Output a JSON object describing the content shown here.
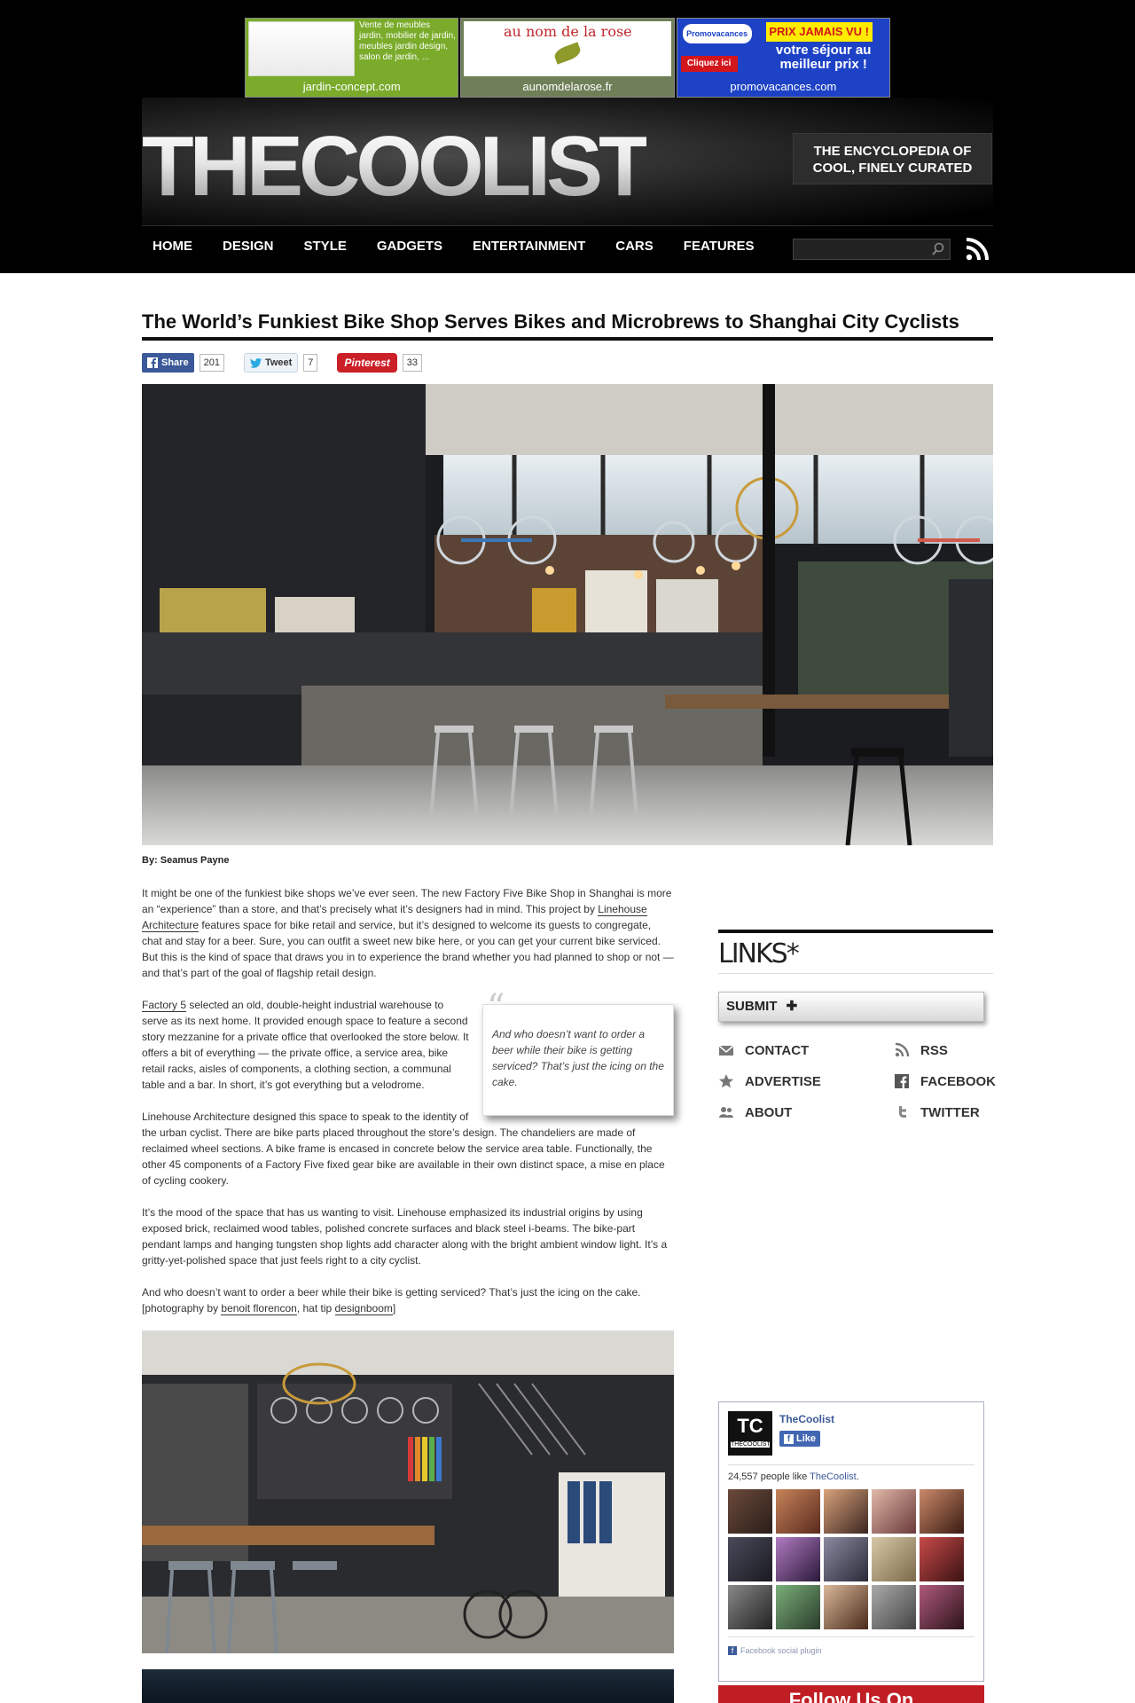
{
  "ads": [
    {
      "text": "Vente de meubles jardin, mobilier de jardin, meubles jardin design, salon de jardin, ...",
      "footer": "jardin-concept.com",
      "color": "#7aab2a"
    },
    {
      "headline": "au nom de la rose",
      "footer": "aunomdelarose.fr",
      "color": "#6f7f58"
    },
    {
      "logo": "Promovacances",
      "cta": "Cliquez ici",
      "badge": "PRIX JAMAIS VU !",
      "offer": "votre séjour au meilleur prix !",
      "footer": "promovacances.com",
      "color": "#1d42c6"
    }
  ],
  "site": {
    "logo": "THECOOLIST",
    "tagline": "THE ENCYCLOPEDIA OF COOL, FINELY CURATED"
  },
  "nav": {
    "items": [
      "HOME",
      "DESIGN",
      "STYLE",
      "GADGETS",
      "ENTERTAINMENT",
      "CARS",
      "FEATURES"
    ],
    "search_placeholder": "",
    "rss_icon": "rss-icon"
  },
  "article": {
    "title": "The World’s Funkiest Bike Shop Serves Bikes and Microbrews to Shanghai City Cyclists",
    "share": {
      "facebook_label": "Share",
      "facebook_count": "201",
      "twitter_label": "Tweet",
      "twitter_count": "7",
      "pinterest_label": "Pinterest",
      "pinterest_count": "33"
    },
    "byline": "By: Seamus Payne",
    "p1_a": "It might be one of the funkiest bike shops we’ve ever seen. The new Factory Five Bike Shop in Shanghai is more an “experience” than a store, and that’s precisely what it’s designers had in mind. This project by ",
    "p1_link": "Linehouse Architecture",
    "p1_b": " features space for bike retail and service, but it’s designed to welcome its guests to congregate, chat and stay for a beer. Sure, you can outfit a sweet new bike here, or you can get your current bike serviced. But this is the kind of space that draws you in to experience the brand whether you had planned to shop or not — and that’s part of the goal of flagship retail design.",
    "quote": "And who doesn’t want to order a beer while their bike is getting serviced? That’s just the icing on the cake.",
    "p2_link": "Factory 5",
    "p2_b": " selected an old, double-height industrial warehouse to serve as its next home. It provided enough space to feature a second story mezzanine for a private office that overlooked the store below. It offers a bit of everything — the private office, a service area, bike retail racks, aisles of components, a clothing section, a communal table and a bar. In short, it’s got everything but a velodrome.",
    "p3": "Linehouse Architecture designed this space to speak to the identity of the urban cyclist. There are bike parts placed throughout the store’s design. The chandeliers are made of reclaimed wheel sections. A bike frame is encased in concrete below the service area table. Functionally, the other 45 components of a Factory Five fixed gear bike are available in their own distinct space, a mise en place of cycling cookery.",
    "p4": "It’s the mood of the space that has us wanting to visit. Linehouse emphasized its industrial origins by using exposed brick, reclaimed wood tables, polished concrete surfaces and black steel i-beams. The bike-part pendant lamps and hanging tungsten shop lights add character along with the bright ambient window light. It’s a gritty-yet-polished space that just feels right to a city cyclist.",
    "p5_a": "And who doesn’t want to order a beer while their bike is getting serviced? That’s just the icing on the cake. [photography by ",
    "p5_link1": "benoit florencon",
    "p5_mid": ", hat tip ",
    "p5_link2": "designboom",
    "p5_end": "]"
  },
  "sidebar": {
    "links_title": "LINKS*",
    "submit_label": "SUBMIT",
    "links": [
      {
        "label": "CONTACT",
        "icon": "mail-icon"
      },
      {
        "label": "RSS",
        "icon": "rss-icon"
      },
      {
        "label": "ADVERTISE",
        "icon": "star-icon"
      },
      {
        "label": "FACEBOOK",
        "icon": "facebook-icon"
      },
      {
        "label": "ABOUT",
        "icon": "people-icon"
      },
      {
        "label": "TWITTER",
        "icon": "twitter-icon"
      }
    ],
    "facebook": {
      "page_name": "TheCoolist",
      "like_label": "Like",
      "count_text": "24,557 people like ",
      "count_link": "TheCoolist",
      "count_end": ".",
      "plugin_label": "Facebook social plugin",
      "logo_text": "TC",
      "logo_sub": "THECOOLIST"
    },
    "follow_label": "Follow Us On"
  }
}
